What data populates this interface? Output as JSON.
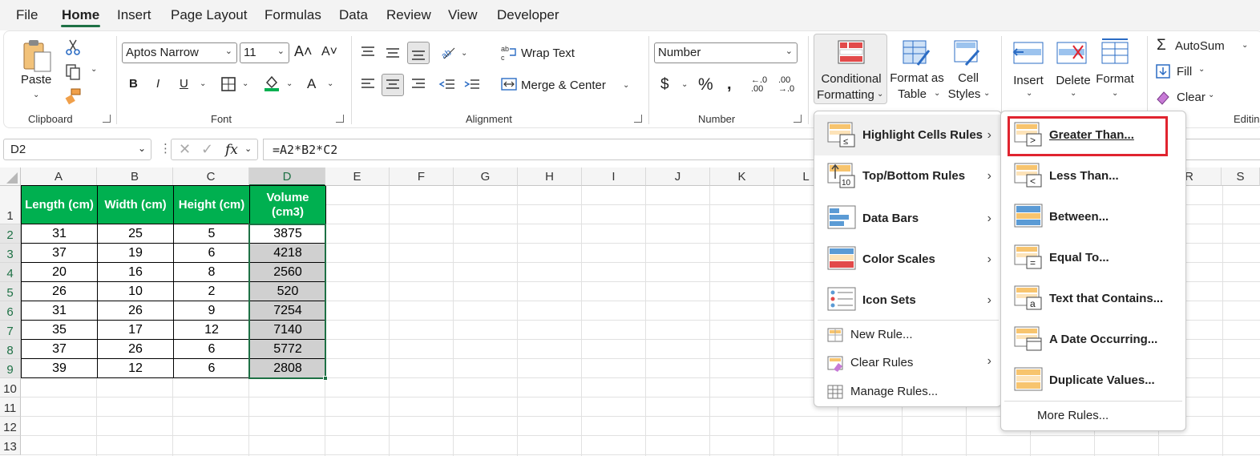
{
  "tabs": [
    "File",
    "Home",
    "Insert",
    "Page Layout",
    "Formulas",
    "Data",
    "Review",
    "View",
    "Developer"
  ],
  "ribbon": {
    "paste_label": "Paste",
    "clipboard_label": "Clipboard",
    "font_label": "Font",
    "font_name": "Aptos Narrow",
    "font_size": "11",
    "alignment_label": "Alignment",
    "wrap_text": "Wrap Text",
    "merge_center": "Merge & Center",
    "number_label": "Number",
    "number_format": "Number",
    "cond_format_line1": "Conditional",
    "cond_format_line2": "Formatting",
    "format_table_line1": "Format as",
    "format_table_line2": "Table",
    "cell_styles_line1": "Cell",
    "cell_styles_line2": "Styles",
    "insert": "Insert",
    "delete": "Delete",
    "format": "Format",
    "autosum": "AutoSum",
    "fill": "Fill",
    "clear": "Clear",
    "editing_label": "Editin"
  },
  "formula_bar": {
    "name_box": "D2",
    "fx": "fx",
    "formula": "=A2*B2*C2"
  },
  "sheet": {
    "columns": [
      "A",
      "B",
      "C",
      "D",
      "E",
      "F",
      "G",
      "H",
      "I",
      "J",
      "K",
      "L",
      "R",
      "S"
    ],
    "rows": [
      "1",
      "2",
      "3",
      "4",
      "5",
      "6",
      "7",
      "8",
      "9",
      "10",
      "11",
      "12",
      "13"
    ],
    "headers": [
      "Length (cm)",
      "Width (cm)",
      "Height (cm)",
      "Volume (cm3)"
    ],
    "data": [
      [
        "31",
        "25",
        "5",
        "3875"
      ],
      [
        "37",
        "19",
        "6",
        "4218"
      ],
      [
        "20",
        "16",
        "8",
        "2560"
      ],
      [
        "26",
        "10",
        "2",
        "520"
      ],
      [
        "31",
        "26",
        "9",
        "7254"
      ],
      [
        "35",
        "17",
        "12",
        "7140"
      ],
      [
        "37",
        "26",
        "6",
        "5772"
      ],
      [
        "39",
        "12",
        "6",
        "2808"
      ]
    ]
  },
  "cf_menu": {
    "items": [
      {
        "label": "Highlight Cells Rules",
        "has_sub": true
      },
      {
        "label": "Top/Bottom Rules",
        "has_sub": true
      },
      {
        "label": "Data Bars",
        "has_sub": true
      },
      {
        "label": "Color Scales",
        "has_sub": true
      },
      {
        "label": "Icon Sets",
        "has_sub": true
      }
    ],
    "new_rule": "New Rule...",
    "clear_rules": "Clear Rules",
    "manage_rules": "Manage Rules..."
  },
  "submenu": {
    "items": [
      "Greater Than...",
      "Less Than...",
      "Between...",
      "Equal To...",
      "Text that Contains...",
      "A Date Occurring...",
      "Duplicate Values..."
    ],
    "more_rules": "More Rules..."
  },
  "colors": {
    "accent_green": "#1e7145",
    "header_fill": "#00b050",
    "highlight_red": "#e0242f"
  }
}
